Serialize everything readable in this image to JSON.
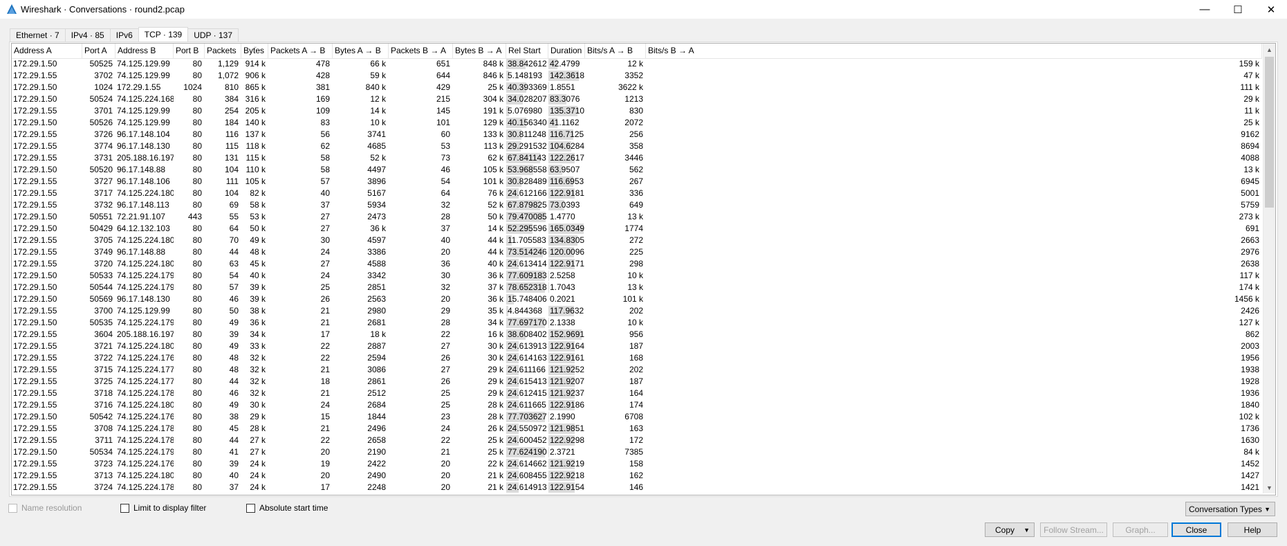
{
  "window": {
    "title": "Wireshark · Conversations · round2.pcap",
    "controls": [
      "minimize",
      "maximize",
      "close"
    ]
  },
  "tabs": [
    {
      "label": "Ethernet · 7",
      "active": false
    },
    {
      "label": "IPv4 · 85",
      "active": false
    },
    {
      "label": "IPv6",
      "active": false
    },
    {
      "label": "TCP · 139",
      "active": true
    },
    {
      "label": "UDP · 137",
      "active": false
    }
  ],
  "table": {
    "columns": [
      "Address A",
      "Port A",
      "Address B",
      "Port B",
      "Packets",
      "Bytes",
      "Packets A → B",
      "Bytes A → B",
      "Packets B → A",
      "Bytes B → A",
      "Rel Start",
      "Duration",
      "Bits/s A → B",
      "Bits/s B → A"
    ],
    "sorted_column": "Bytes",
    "rows": [
      [
        "172.29.1.50",
        "50525",
        "74.125.129.99",
        "80",
        "1,129",
        "914 k",
        "478",
        "66 k",
        "651",
        "848 k",
        "38.842612",
        "42.4799",
        "12 k",
        "159 k"
      ],
      [
        "172.29.1.55",
        "3702",
        "74.125.129.99",
        "80",
        "1,072",
        "906 k",
        "428",
        "59 k",
        "644",
        "846 k",
        "5.148193",
        "142.3618",
        "3352",
        "47 k"
      ],
      [
        "172.29.1.50",
        "1024",
        "172.29.1.55",
        "1024",
        "810",
        "865 k",
        "381",
        "840 k",
        "429",
        "25 k",
        "40.393369",
        "1.8551",
        "3622 k",
        "111 k"
      ],
      [
        "172.29.1.50",
        "50524",
        "74.125.224.168",
        "80",
        "384",
        "316 k",
        "169",
        "12 k",
        "215",
        "304 k",
        "34.028207",
        "83.3076",
        "1213",
        "29 k"
      ],
      [
        "172.29.1.55",
        "3701",
        "74.125.129.99",
        "80",
        "254",
        "205 k",
        "109",
        "14 k",
        "145",
        "191 k",
        "5.076980",
        "135.3710",
        "830",
        "11 k"
      ],
      [
        "172.29.1.50",
        "50526",
        "74.125.129.99",
        "80",
        "184",
        "140 k",
        "83",
        "10 k",
        "101",
        "129 k",
        "40.156340",
        "41.1162",
        "2072",
        "25 k"
      ],
      [
        "172.29.1.55",
        "3726",
        "96.17.148.104",
        "80",
        "116",
        "137 k",
        "56",
        "3741",
        "60",
        "133 k",
        "30.811248",
        "116.7125",
        "256",
        "9162"
      ],
      [
        "172.29.1.55",
        "3774",
        "96.17.148.130",
        "80",
        "115",
        "118 k",
        "62",
        "4685",
        "53",
        "113 k",
        "29.291532",
        "104.6284",
        "358",
        "8694"
      ],
      [
        "172.29.1.55",
        "3731",
        "205.188.16.197",
        "80",
        "131",
        "115 k",
        "58",
        "52 k",
        "73",
        "62 k",
        "67.841143",
        "122.2617",
        "3446",
        "4088"
      ],
      [
        "172.29.1.50",
        "50520",
        "96.17.148.88",
        "80",
        "104",
        "110 k",
        "58",
        "4497",
        "46",
        "105 k",
        "53.968558",
        "63.9507",
        "562",
        "13 k"
      ],
      [
        "172.29.1.55",
        "3727",
        "96.17.148.106",
        "80",
        "111",
        "105 k",
        "57",
        "3896",
        "54",
        "101 k",
        "30.828489",
        "116.6953",
        "267",
        "6945"
      ],
      [
        "172.29.1.55",
        "3717",
        "74.125.224.180",
        "80",
        "104",
        "82 k",
        "40",
        "5167",
        "64",
        "76 k",
        "24.612166",
        "122.9181",
        "336",
        "5001"
      ],
      [
        "172.29.1.55",
        "3732",
        "96.17.148.113",
        "80",
        "69",
        "58 k",
        "37",
        "5934",
        "32",
        "52 k",
        "67.879825",
        "73.0393",
        "649",
        "5759"
      ],
      [
        "172.29.1.50",
        "50551",
        "72.21.91.107",
        "443",
        "55",
        "53 k",
        "27",
        "2473",
        "28",
        "50 k",
        "79.470085",
        "1.4770",
        "13 k",
        "273 k"
      ],
      [
        "172.29.1.50",
        "50429",
        "64.12.132.103",
        "80",
        "64",
        "50 k",
        "27",
        "36 k",
        "37",
        "14 k",
        "52.295596",
        "165.0349",
        "1774",
        "691"
      ],
      [
        "172.29.1.55",
        "3705",
        "74.125.224.180",
        "80",
        "70",
        "49 k",
        "30",
        "4597",
        "40",
        "44 k",
        "11.705583",
        "134.8305",
        "272",
        "2663"
      ],
      [
        "172.29.1.55",
        "3749",
        "96.17.148.88",
        "80",
        "44",
        "48 k",
        "24",
        "3386",
        "20",
        "44 k",
        "73.514246",
        "120.0096",
        "225",
        "2976"
      ],
      [
        "172.29.1.55",
        "3720",
        "74.125.224.180",
        "80",
        "63",
        "45 k",
        "27",
        "4588",
        "36",
        "40 k",
        "24.613414",
        "122.9171",
        "298",
        "2638"
      ],
      [
        "172.29.1.50",
        "50533",
        "74.125.224.179",
        "80",
        "54",
        "40 k",
        "24",
        "3342",
        "30",
        "36 k",
        "77.609183",
        "2.5258",
        "10 k",
        "117 k"
      ],
      [
        "172.29.1.50",
        "50544",
        "74.125.224.179",
        "80",
        "57",
        "39 k",
        "25",
        "2851",
        "32",
        "37 k",
        "78.652318",
        "1.7043",
        "13 k",
        "174 k"
      ],
      [
        "172.29.1.50",
        "50569",
        "96.17.148.130",
        "80",
        "46",
        "39 k",
        "26",
        "2563",
        "20",
        "36 k",
        "15.748406",
        "0.2021",
        "101 k",
        "1456 k"
      ],
      [
        "172.29.1.55",
        "3700",
        "74.125.129.99",
        "80",
        "50",
        "38 k",
        "21",
        "2980",
        "29",
        "35 k",
        "4.844368",
        "117.9632",
        "202",
        "2426"
      ],
      [
        "172.29.1.50",
        "50535",
        "74.125.224.179",
        "80",
        "49",
        "36 k",
        "21",
        "2681",
        "28",
        "34 k",
        "77.697170",
        "2.1338",
        "10 k",
        "127 k"
      ],
      [
        "172.29.1.55",
        "3604",
        "205.188.16.197",
        "80",
        "39",
        "34 k",
        "17",
        "18 k",
        "22",
        "16 k",
        "38.608402",
        "152.9691",
        "956",
        "862"
      ],
      [
        "172.29.1.55",
        "3721",
        "74.125.224.180",
        "80",
        "49",
        "33 k",
        "22",
        "2887",
        "27",
        "30 k",
        "24.613913",
        "122.9164",
        "187",
        "2003"
      ],
      [
        "172.29.1.55",
        "3722",
        "74.125.224.176",
        "80",
        "48",
        "32 k",
        "22",
        "2594",
        "26",
        "30 k",
        "24.614163",
        "122.9161",
        "168",
        "1956"
      ],
      [
        "172.29.1.55",
        "3715",
        "74.125.224.177",
        "80",
        "48",
        "32 k",
        "21",
        "3086",
        "27",
        "29 k",
        "24.611166",
        "121.9252",
        "202",
        "1938"
      ],
      [
        "172.29.1.55",
        "3725",
        "74.125.224.177",
        "80",
        "44",
        "32 k",
        "18",
        "2861",
        "26",
        "29 k",
        "24.615413",
        "121.9207",
        "187",
        "1928"
      ],
      [
        "172.29.1.55",
        "3718",
        "74.125.224.178",
        "80",
        "46",
        "32 k",
        "21",
        "2512",
        "25",
        "29 k",
        "24.612415",
        "121.9237",
        "164",
        "1936"
      ],
      [
        "172.29.1.55",
        "3716",
        "74.125.224.180",
        "80",
        "49",
        "30 k",
        "24",
        "2684",
        "25",
        "28 k",
        "24.611665",
        "122.9186",
        "174",
        "1840"
      ],
      [
        "172.29.1.50",
        "50542",
        "74.125.224.176",
        "80",
        "38",
        "29 k",
        "15",
        "1844",
        "23",
        "28 k",
        "77.703627",
        "2.1990",
        "6708",
        "102 k"
      ],
      [
        "172.29.1.55",
        "3708",
        "74.125.224.178",
        "80",
        "45",
        "28 k",
        "21",
        "2496",
        "24",
        "26 k",
        "24.550972",
        "121.9851",
        "163",
        "1736"
      ],
      [
        "172.29.1.55",
        "3711",
        "74.125.224.178",
        "80",
        "44",
        "27 k",
        "22",
        "2658",
        "22",
        "25 k",
        "24.600452",
        "122.9298",
        "172",
        "1630"
      ],
      [
        "172.29.1.50",
        "50534",
        "74.125.224.179",
        "80",
        "41",
        "27 k",
        "20",
        "2190",
        "21",
        "25 k",
        "77.624190",
        "2.3721",
        "7385",
        "84 k"
      ],
      [
        "172.29.1.55",
        "3723",
        "74.125.224.176",
        "80",
        "39",
        "24 k",
        "19",
        "2422",
        "20",
        "22 k",
        "24.614662",
        "121.9219",
        "158",
        "1452"
      ],
      [
        "172.29.1.55",
        "3713",
        "74.125.224.180",
        "80",
        "40",
        "24 k",
        "20",
        "2490",
        "20",
        "21 k",
        "24.608455",
        "122.9218",
        "162",
        "1427"
      ],
      [
        "172.29.1.55",
        "3724",
        "74.125.224.178",
        "80",
        "37",
        "24 k",
        "17",
        "2248",
        "20",
        "21 k",
        "24.614913",
        "122.9154",
        "146",
        "1421"
      ]
    ]
  },
  "footer": {
    "name_resolution": "Name resolution",
    "limit_to_display_filter": "Limit to display filter",
    "absolute_start_time": "Absolute start time",
    "conversation_types": "Conversation Types",
    "buttons": {
      "copy": "Copy",
      "follow_stream": "Follow Stream...",
      "graph": "Graph...",
      "close": "Close",
      "help": "Help"
    }
  },
  "colors": {
    "accent": "#0078d7",
    "bar_fill": "#dcdcdc",
    "wireshark_fin": "#1e73be"
  }
}
